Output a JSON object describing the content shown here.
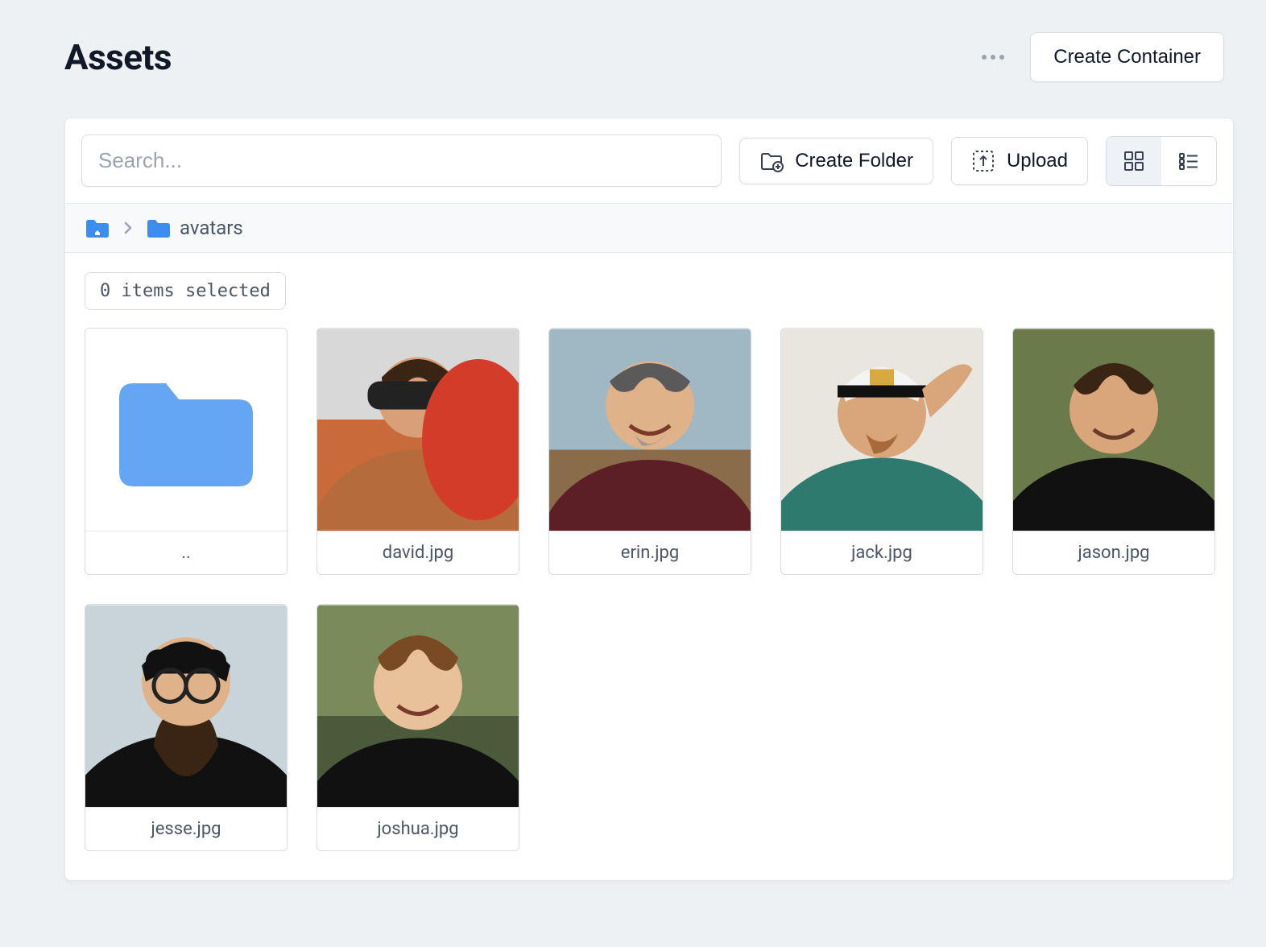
{
  "header": {
    "title": "Assets",
    "create_container_label": "Create Container"
  },
  "toolbar": {
    "search_placeholder": "Search...",
    "create_folder_label": "Create Folder",
    "upload_label": "Upload"
  },
  "breadcrumb": {
    "current_folder": "avatars"
  },
  "selection": {
    "label": "0 items selected"
  },
  "items": [
    {
      "type": "up",
      "name": ".."
    },
    {
      "type": "file",
      "name": "david.jpg"
    },
    {
      "type": "file",
      "name": "erin.jpg"
    },
    {
      "type": "file",
      "name": "jack.jpg"
    },
    {
      "type": "file",
      "name": "jason.jpg"
    },
    {
      "type": "file",
      "name": "jesse.jpg"
    },
    {
      "type": "file",
      "name": "joshua.jpg"
    }
  ]
}
